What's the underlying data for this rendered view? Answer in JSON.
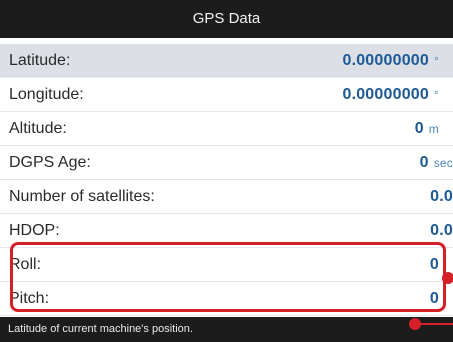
{
  "header": {
    "title": "GPS Data"
  },
  "rows": [
    {
      "label": "Latitude:",
      "value": "0.00000000",
      "unit": "°"
    },
    {
      "label": "Longitude:",
      "value": "0.00000000",
      "unit": "°"
    },
    {
      "label": "Altitude:",
      "value": "0",
      "unit": "m"
    },
    {
      "label": "DGPS Age:",
      "value": "0",
      "unit": "sec"
    },
    {
      "label": "Number of satellites:",
      "value": "0.0",
      "unit": ""
    },
    {
      "label": "HDOP:",
      "value": "0.0",
      "unit": ""
    },
    {
      "label": "Roll:",
      "value": "0",
      "unit": ""
    },
    {
      "label": "Pitch:",
      "value": "0",
      "unit": ""
    }
  ],
  "status": {
    "text": "Latitude of current machine's position."
  },
  "colors": {
    "highlight": "#d5202a",
    "value": "#1e5a96",
    "header": "#1c1c1c"
  }
}
